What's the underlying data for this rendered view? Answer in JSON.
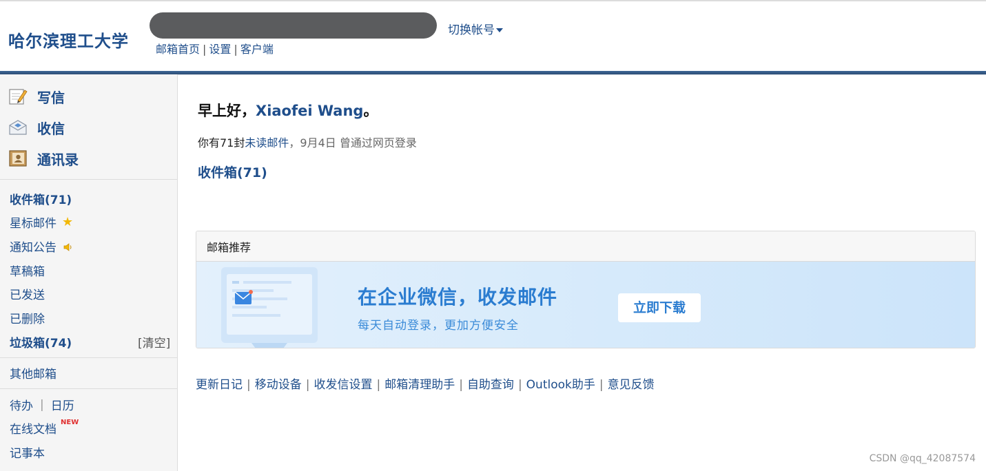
{
  "header": {
    "logo": "哈尔滨理工大学",
    "switch_account": "切换帐号",
    "links": [
      "邮箱首页",
      "设置",
      "客户端"
    ]
  },
  "sidebar": {
    "actions": [
      {
        "label": "写信",
        "icon": "compose-icon"
      },
      {
        "label": "收信",
        "icon": "inbox-receive-icon"
      },
      {
        "label": "通讯录",
        "icon": "contacts-icon"
      }
    ],
    "folders": {
      "inbox": "收件箱(71)",
      "starred": "星标邮件",
      "notices": "通知公告",
      "drafts": "草稿箱",
      "sent": "已发送",
      "deleted": "已删除",
      "spam": "垃圾箱(74)",
      "spam_clear": "[清空]",
      "other_mailboxes": "其他邮箱"
    },
    "tools": {
      "todo": "待办",
      "calendar": "日历",
      "online_docs": "在线文档",
      "new_badge": "NEW",
      "notebook": "记事本"
    }
  },
  "main": {
    "greeting_prefix": "早上好，",
    "user_name": "Xiaofei Wang",
    "greeting_suffix": "。",
    "unread_prefix": "你有71封",
    "unread_link": "未读邮件",
    "last_login": "，9月4日 曾通过网页登录",
    "inbox_link": "收件箱(71)",
    "recommend": {
      "header": "邮箱推荐",
      "title": "在企业微信，收发邮件",
      "subtitle": "每天自动登录，更加方便安全",
      "button": "立即下载"
    },
    "footer_links": [
      "更新日记",
      "移动设备",
      "收发信设置",
      "邮箱清理助手",
      "自助查询",
      "Outlook助手",
      "意见反馈"
    ]
  },
  "watermark": "CSDN @qq_42087574",
  "colors": {
    "brand": "#1f4e8b",
    "header_bar": "#2c4d75",
    "banner_text": "#2a7cd0"
  }
}
